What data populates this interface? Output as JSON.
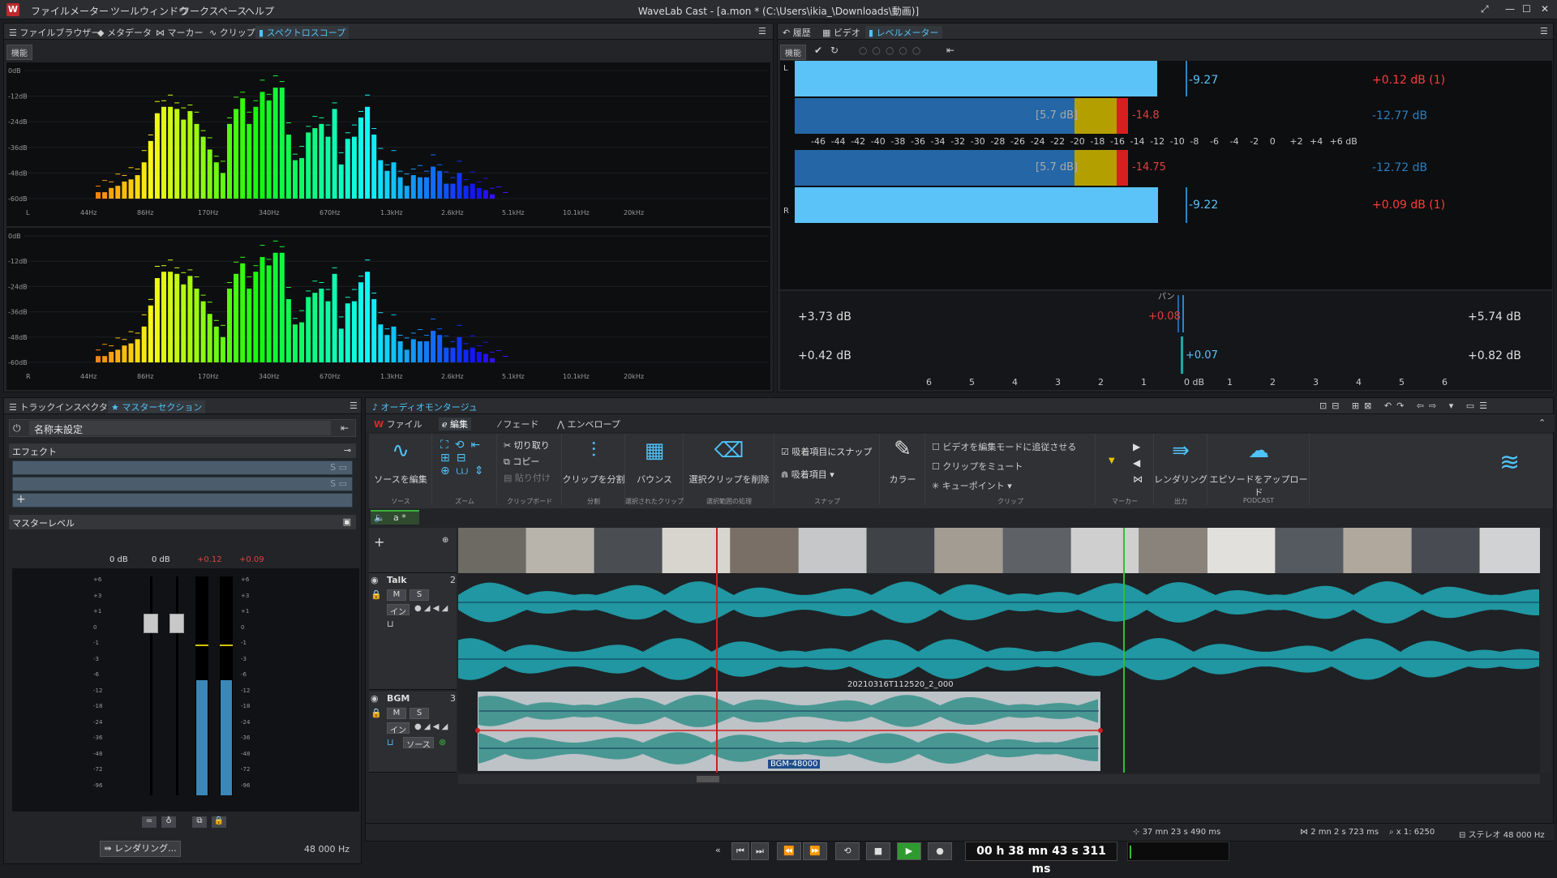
{
  "app": {
    "title": "WaveLab Cast - [a.mon * (C:\\Users\\ikia_\\Downloads\\動画)]",
    "logo": "W",
    "menu": [
      "ファイル",
      "メーター",
      "ツールウィンドウ",
      "ワークスペース",
      "ヘルプ"
    ]
  },
  "colors": {
    "accent": "#4fc3f7",
    "red": "#e0262a",
    "bg": "#1b1d20"
  },
  "spectro_panel": {
    "tabs": [
      "ファイルブラウザー",
      "メタデータ",
      "マーカー",
      "クリップ",
      "スペクトロスコープ"
    ],
    "active_tab": "スペクトロスコープ",
    "func_btn": "機能",
    "db_ticks": [
      "0dB",
      "-12dB",
      "-24dB",
      "-36dB",
      "-48dB",
      "-60dB"
    ],
    "freq_ticks": [
      "44Hz",
      "86Hz",
      "170Hz",
      "340Hz",
      "670Hz",
      "1.3kHz",
      "2.6kHz",
      "5.1kHz",
      "10.1kHz",
      "20kHz"
    ],
    "ch_labels": [
      "L",
      "R"
    ],
    "bar_levels": [
      -60,
      -60,
      -58,
      -57,
      -55,
      -54,
      -52,
      -46,
      -36,
      -23,
      -20,
      -20,
      -21,
      -26,
      -22,
      -28,
      -34,
      -40,
      -46,
      -51,
      -28,
      -21,
      -16,
      -28,
      -20,
      -13,
      -17,
      -11,
      -11,
      -33,
      -45,
      -44,
      -32,
      -30,
      -28,
      -34,
      -21,
      -47,
      -35,
      -34,
      -25,
      -20,
      -33,
      -45,
      -50,
      -46,
      -53,
      -57,
      -52,
      -53,
      -53,
      -48,
      -50,
      -56,
      -56,
      -51,
      -57,
      -56,
      -58,
      -59,
      -61,
      -63,
      -63
    ]
  },
  "level_panel": {
    "tabs": [
      "履歴",
      "ビデオ",
      "レベルメーター"
    ],
    "active_tab": "レベルメーター",
    "func_btn": "機能",
    "ch_labels": [
      "L",
      "R"
    ],
    "L": {
      "rms": "-9.27",
      "peak": "+0.12 dB (1)",
      "avg": "[5.7 dB]",
      "lo": "-14.8",
      "lo2": "-12.77 dB"
    },
    "R": {
      "rms": "-9.22",
      "peak": "+0.09 dB (1)",
      "avg": "[5.7 dB]",
      "lo": "-14.75",
      "lo2": "-12.72 dB"
    },
    "scale": [
      "-46",
      "-44",
      "-42",
      "-40",
      "-38",
      "-36",
      "-34",
      "-32",
      "-30",
      "-28",
      "-26",
      "-24",
      "-22",
      "-20",
      "-18",
      "-16",
      "-14",
      "-12",
      "-10",
      "-8",
      "-6",
      "-4",
      "-2",
      "0",
      "+2",
      "+4",
      "+6 dB"
    ],
    "pan_title": "パン",
    "pan": {
      "l1": "+3.73 dB",
      "c1": "+0.08",
      "r1": "+5.74 dB",
      "l2": "+0.42 dB",
      "c2": "+0.07",
      "r2": "+0.82 dB"
    },
    "pan_scale": [
      "6",
      "5",
      "4",
      "3",
      "2",
      "1",
      "0 dB",
      "1",
      "2",
      "3",
      "4",
      "5",
      "6"
    ]
  },
  "master_panel": {
    "tabs": [
      "トラックインスペクター",
      "マスターセクション"
    ],
    "active_tab": "マスターセクション",
    "preset_name": "名称未設定",
    "effects_title": "エフェクト",
    "master_level_title": "マスターレベル",
    "fader_vals": [
      "0 dB",
      "0 dB",
      "+0.12",
      "+0.09"
    ],
    "fader_scale": [
      "+6",
      "+3",
      "+1",
      "0",
      "-1",
      "-3",
      "-6",
      "-12",
      "-18",
      "-24",
      "-36",
      "-48",
      "-72",
      "-96"
    ],
    "render_btn": "レンダリング...",
    "sample_rate": "48 000 Hz"
  },
  "montage": {
    "title": "オーディオモンタージュ",
    "tabs": [
      "ファイル",
      "編集",
      "フェード",
      "エンベロープ"
    ],
    "active_tab": "編集",
    "toolbar": {
      "edit_source": "ソースを編集",
      "split": "クリップを分割",
      "bounce": "バウンス",
      "delete_sel": "選択クリップを削除",
      "cut": "切り取り",
      "copy": "コピー",
      "paste": "貼り付け",
      "snap": "吸着項目にスナップ",
      "snap_items": "吸着項目",
      "color": "カラー",
      "video_follow": "ビデオを編集モードに追従させる",
      "mute": "クリップをミュート",
      "cue": "キューポイント",
      "render": "レンダリング",
      "upload": "エピソードをアップロード",
      "groups": [
        "ソース",
        "ズーム",
        "クリップボード",
        "分割",
        "選択されたクリップ",
        "選択範囲の処理",
        "スナップ",
        "クリップ",
        "マーカー",
        "出力",
        "PODCAST"
      ]
    },
    "montage_tab": "a *",
    "tracks": [
      {
        "name": "Talk",
        "num": "2",
        "m": "M",
        "s": "S",
        "in": "イン"
      },
      {
        "name": "BGM",
        "num": "3",
        "m": "M",
        "s": "S",
        "in": "イン",
        "source": "ソース"
      }
    ],
    "clip_names": [
      "20210316T112520_2_000",
      "BGM-48000"
    ],
    "status": {
      "cursor": "37 mn 23 s 490 ms",
      "length": "2 mn 2 s 723 ms",
      "zoom": "x 1: 6250",
      "format": "ステレオ 48 000 Hz"
    },
    "timecode": "00 h 38 mn 43 s 311 ms"
  }
}
